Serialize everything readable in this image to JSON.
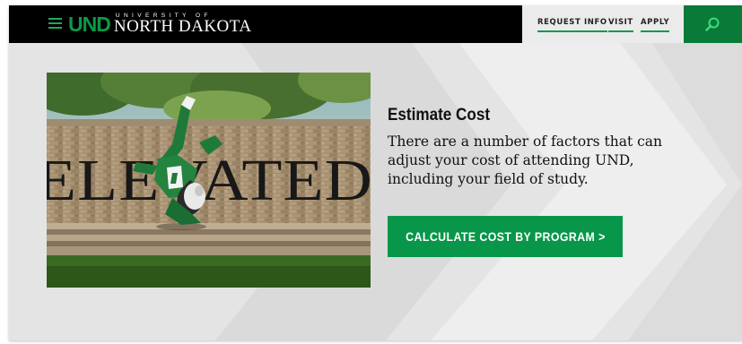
{
  "header": {
    "logo_mark": "UND",
    "logo_university": "UNIVERSITY OF",
    "logo_name": "NORTH DAKOTA",
    "nav": {
      "request_info": "REQUEST INFO",
      "visit": "VISIT",
      "apply": "APPLY"
    },
    "icons": [
      "menu-icon",
      "search-icon"
    ]
  },
  "photo": {
    "sign_text": "ELEVATED"
  },
  "main": {
    "title": "Estimate Cost",
    "body": "There are a number of factors that can adjust your cost of attending UND, including your field of study.",
    "cta_label": "CALCULATE COST BY PROGRAM >"
  },
  "colors": {
    "brand_green": "#08964a",
    "header_bg": "#000000",
    "utility_bg": "#ebebeb",
    "search_bg": "#0a7a38",
    "page_bg": "#e4e4e4"
  }
}
